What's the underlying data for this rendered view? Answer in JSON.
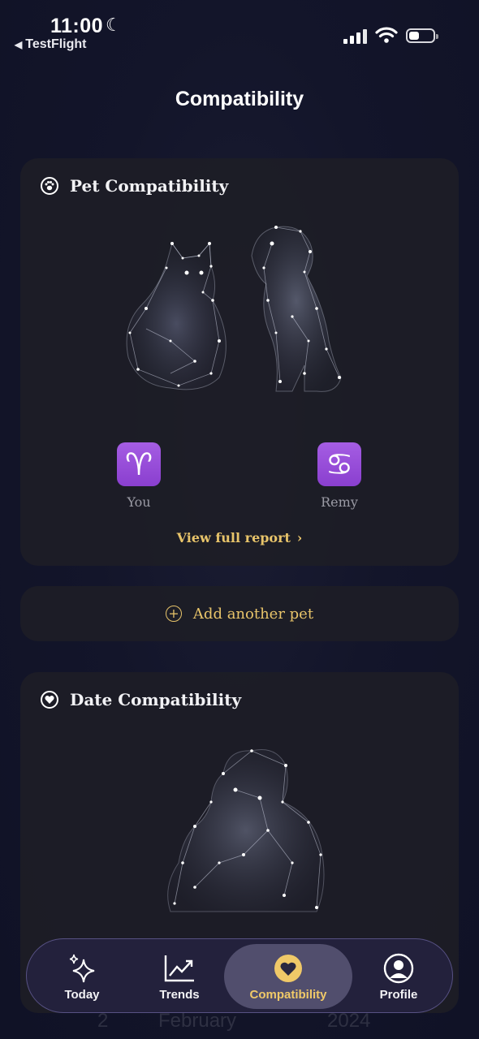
{
  "status_bar": {
    "time": "11:00",
    "back_app": "TestFlight"
  },
  "page": {
    "title": "Compatibility"
  },
  "pet_card": {
    "title": "Pet Compatibility",
    "user_sign_label": "You",
    "pet_sign_label": "Remy",
    "user_sign_glyph": "♈",
    "pet_sign_glyph": "♋",
    "report_link": "View full report"
  },
  "add_pet": {
    "label": "Add another pet"
  },
  "date_card": {
    "title": "Date Compatibility"
  },
  "background_calendar": {
    "day": "2",
    "month": "February",
    "year": "2024"
  },
  "tabs": [
    {
      "label": "Today",
      "icon": "sparkles-icon",
      "active": false
    },
    {
      "label": "Trends",
      "icon": "trend-chart-icon",
      "active": false
    },
    {
      "label": "Compatibility",
      "icon": "heart-icon",
      "active": true
    },
    {
      "label": "Profile",
      "icon": "person-icon",
      "active": false
    }
  ],
  "colors": {
    "accent_gold": "#e8c46a",
    "zodiac_purple": "#9a4ee0",
    "card_bg": "#1e1e26",
    "background": "#13152a"
  }
}
